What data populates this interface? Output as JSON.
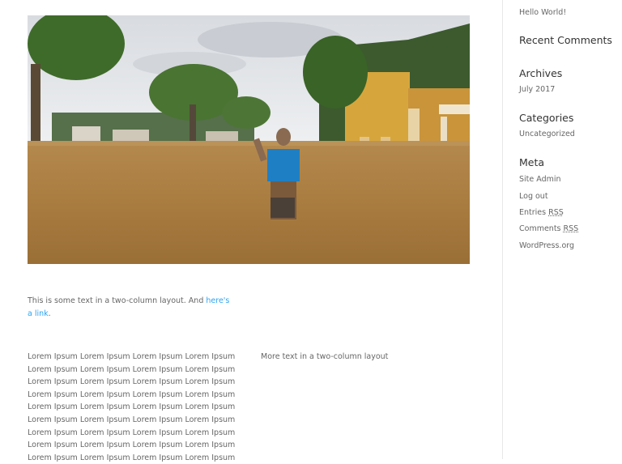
{
  "post": {
    "intro_text": "This is some text in a two-column layout. And ",
    "intro_link": "here's a link",
    "intro_end": ".",
    "lorem_lines": [
      "Lorem Ipsum Lorem Ipsum Lorem Ipsum Lorem Ipsum",
      "Lorem Ipsum Lorem Ipsum Lorem Ipsum Lorem Ipsum",
      "Lorem Ipsum Lorem Ipsum Lorem Ipsum Lorem Ipsum",
      "Lorem Ipsum Lorem Ipsum Lorem Ipsum Lorem Ipsum",
      "Lorem Ipsum Lorem Ipsum Lorem Ipsum Lorem Ipsum",
      "Lorem Ipsum Lorem Ipsum Lorem Ipsum Lorem Ipsum",
      "Lorem Ipsum Lorem Ipsum Lorem Ipsum Lorem Ipsum",
      "Lorem Ipsum Lorem Ipsum Lorem Ipsum Lorem Ipsum",
      "Lorem Ipsum Lorem Ipsum Lorem Ipsum Lorem Ipsum"
    ],
    "column2_text": "More text in a two-column layout"
  },
  "sidebar": {
    "recent_post": "Hello World!",
    "recent_comments_heading": "Recent Comments",
    "archives_heading": "Archives",
    "archive_item": "July 2017",
    "categories_heading": "Categories",
    "category_item": "Uncategorized",
    "meta_heading": "Meta",
    "meta_site_admin": "Site Admin",
    "meta_log_out": "Log out",
    "meta_entries_prefix": "Entries ",
    "meta_comments_prefix": "Comments ",
    "meta_rss": "RSS",
    "meta_wordpress": "WordPress.org"
  },
  "colors": {
    "link": "#2ea3f2",
    "text": "#666666",
    "heading": "#333333"
  }
}
